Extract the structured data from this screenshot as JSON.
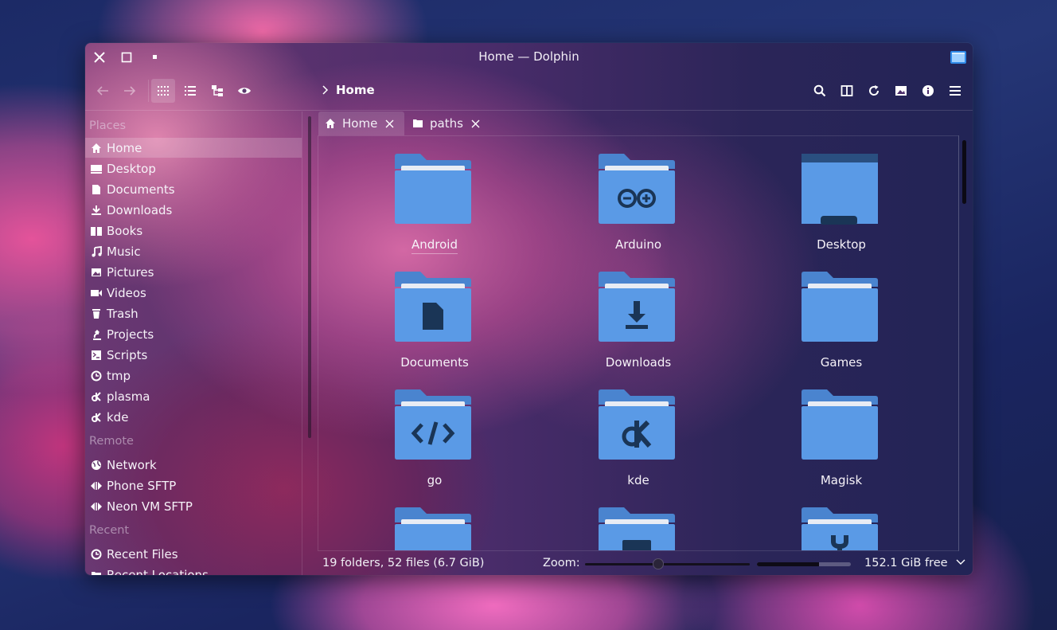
{
  "window": {
    "title": "Home — Dolphin"
  },
  "toolbar": {
    "breadcrumb": "Home",
    "view_mode_active": "icons"
  },
  "sidebar": {
    "sections": [
      {
        "heading": "Places",
        "items": [
          {
            "label": "Home",
            "icon": "home-icon",
            "selected": true
          },
          {
            "label": "Desktop",
            "icon": "desktop-icon"
          },
          {
            "label": "Documents",
            "icon": "document-icon"
          },
          {
            "label": "Downloads",
            "icon": "download-icon"
          },
          {
            "label": "Books",
            "icon": "book-icon"
          },
          {
            "label": "Music",
            "icon": "music-icon"
          },
          {
            "label": "Pictures",
            "icon": "picture-icon"
          },
          {
            "label": "Videos",
            "icon": "video-icon"
          },
          {
            "label": "Trash",
            "icon": "trash-icon"
          },
          {
            "label": "Projects",
            "icon": "microscope-icon"
          },
          {
            "label": "Scripts",
            "icon": "terminal-icon"
          },
          {
            "label": "tmp",
            "icon": "clock-icon"
          },
          {
            "label": "plasma",
            "icon": "kde-icon"
          },
          {
            "label": "kde",
            "icon": "kde-icon"
          }
        ]
      },
      {
        "heading": "Remote",
        "items": [
          {
            "label": "Network",
            "icon": "globe-icon"
          },
          {
            "label": "Phone SFTP",
            "icon": "remote-icon"
          },
          {
            "label": "Neon VM SFTP",
            "icon": "remote-icon"
          }
        ]
      },
      {
        "heading": "Recent",
        "items": [
          {
            "label": "Recent Files",
            "icon": "clock-icon"
          },
          {
            "label": "Recent Locations",
            "icon": "folder-icon"
          }
        ]
      }
    ]
  },
  "tabs": [
    {
      "label": "Home",
      "icon": "home-icon",
      "active": true
    },
    {
      "label": "paths",
      "icon": "folder-icon",
      "active": false
    }
  ],
  "files": [
    {
      "name": "Android",
      "emblem": "none"
    },
    {
      "name": "Arduino",
      "emblem": "arduino"
    },
    {
      "name": "Desktop",
      "emblem": "desktop"
    },
    {
      "name": "Documents",
      "emblem": "document"
    },
    {
      "name": "Downloads",
      "emblem": "download"
    },
    {
      "name": "Games",
      "emblem": "none"
    },
    {
      "name": "go",
      "emblem": "code"
    },
    {
      "name": "kde",
      "emblem": "kde"
    },
    {
      "name": "Magisk",
      "emblem": "none"
    },
    {
      "name": "",
      "emblem": "none"
    },
    {
      "name": "",
      "emblem": "picture"
    },
    {
      "name": "",
      "emblem": "wrench"
    }
  ],
  "status": {
    "summary": "19 folders, 52 files (6.7 GiB)",
    "zoom_label": "Zoom:",
    "zoom_level": 0.44,
    "disk_used_fraction": 0.66,
    "free_space": "152.1 GiB free"
  },
  "colors": {
    "folder": "#5a9ae6",
    "folder_tab": "#4a84cf",
    "emblem": "#1a3556"
  }
}
